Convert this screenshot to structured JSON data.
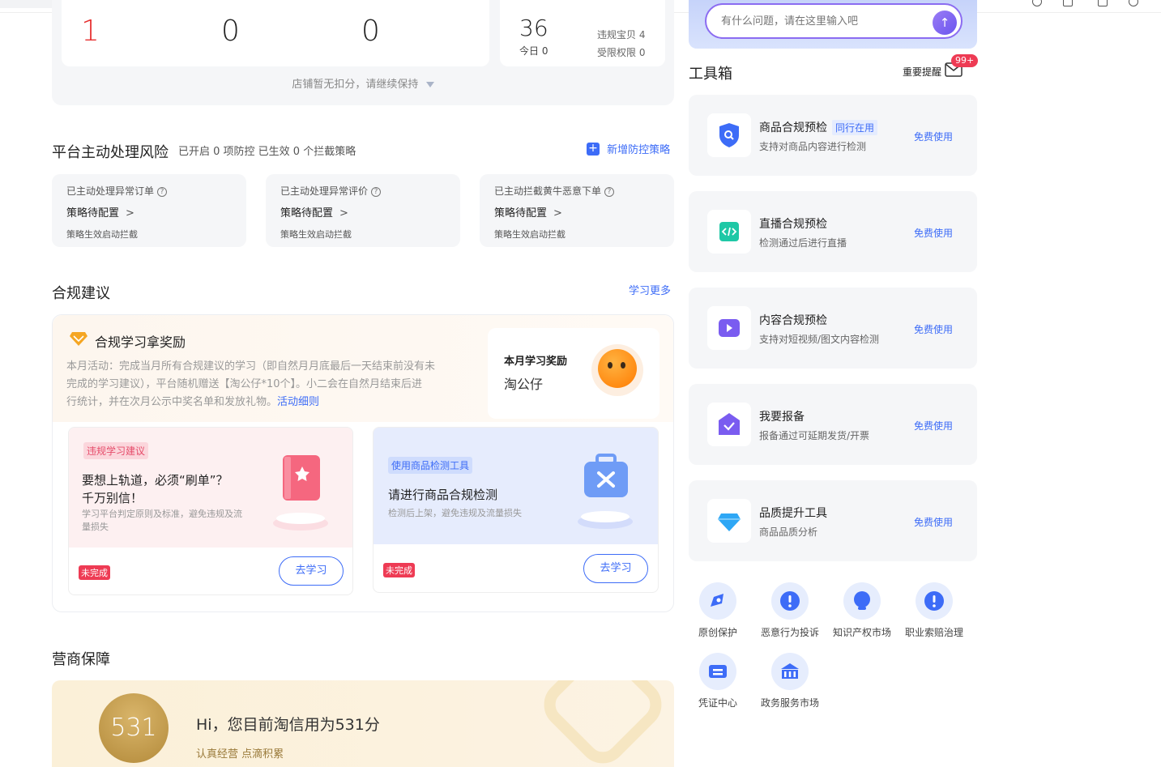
{
  "stats": {
    "values": [
      "1",
      "0",
      "0"
    ],
    "violations_count": "36",
    "today": "今日 0",
    "violation_items": "违规宝贝 4",
    "restricted": "受限权限 0",
    "deduct_note": "店铺暂无扣分，请继续保持"
  },
  "platform_risk": {
    "title": "平台主动处理风险",
    "summary": "已开启 0 项防控 已生效 0 个拦截策略",
    "add_label": "新增防控策略",
    "cards": [
      {
        "title": "已主动处理异常订单",
        "status": "策略待配置",
        "note": "策略生效启动拦截"
      },
      {
        "title": "已主动处理异常评价",
        "status": "策略待配置",
        "note": "策略生效启动拦截"
      },
      {
        "title": "已主动拦截黄牛恶意下单",
        "status": "策略待配置",
        "note": "策略生效启动拦截"
      }
    ]
  },
  "compliance": {
    "title": "合规建议",
    "more": "学习更多",
    "reward_title": "合规学习拿奖励",
    "reward_desc_1": "本月活动：完成当月所有合规建议的学习（即自然月月底最后一天结束前没有未",
    "reward_desc_2": "完成的学习建议），平台随机赠送【淘公仔*10个】。小二会在自然月结束后进",
    "reward_desc_3": "行统计，并在次月公示中奖名单和发放礼物。",
    "reward_link": "活动细则",
    "month_reward_label": "本月学习奖励",
    "month_reward_value": "淘公仔",
    "card_a": {
      "tag": "违规学习建议",
      "title_1": "要想上轨道，必须“刷单”？",
      "title_2": "千万别信！",
      "desc_1": "学习平台判定原则及标准，避免违规及流",
      "desc_2": "量损失",
      "status": "未完成",
      "button": "去学习"
    },
    "card_b": {
      "tag": "使用商品检测工具",
      "title": "请进行商品合规检测",
      "desc": "检测后上架，避免违规及流量损失",
      "status": "未完成",
      "button": "去学习"
    }
  },
  "guarantee": {
    "title": "营商保障",
    "score": "531",
    "greeting": "Hi，您目前淘信用为531分",
    "slogan": "认真经营 点滴积累"
  },
  "assistant": {
    "placeholder": "有什么问题，请在这里输入吧"
  },
  "toolbox": {
    "title": "工具箱",
    "reminder": "重要提醒",
    "badge": "99+",
    "tools": [
      {
        "name": "商品合规预检",
        "peer": "同行在用",
        "desc": "支持对商品内容进行检测",
        "action": "免费使用",
        "icon": "shield-search-icon",
        "color": "#3d6cf7"
      },
      {
        "name": "直播合规预检",
        "peer": "",
        "desc": "检测通过后进行直播",
        "action": "免费使用",
        "icon": "code-icon",
        "color": "#1fc8a6"
      },
      {
        "name": "内容合规预检",
        "peer": "",
        "desc": "支持对短视频/图文内容检测",
        "action": "免费使用",
        "icon": "video-icon",
        "color": "#7a5cf0"
      },
      {
        "name": "我要报备",
        "peer": "",
        "desc": "报备通过可延期发货/开票",
        "action": "免费使用",
        "icon": "check-house-icon",
        "color": "#7a5cf0"
      },
      {
        "name": "品质提升工具",
        "peer": "",
        "desc": "商品品质分析",
        "action": "免费使用",
        "icon": "diamond-icon",
        "color": "#2ea7f5"
      }
    ],
    "quick_links": [
      {
        "label": "原创保护"
      },
      {
        "label": "恶意行为投诉"
      },
      {
        "label": "知识产权市场"
      },
      {
        "label": "职业索赔治理"
      },
      {
        "label": "凭证中心"
      },
      {
        "label": "政务服务市场"
      }
    ]
  }
}
